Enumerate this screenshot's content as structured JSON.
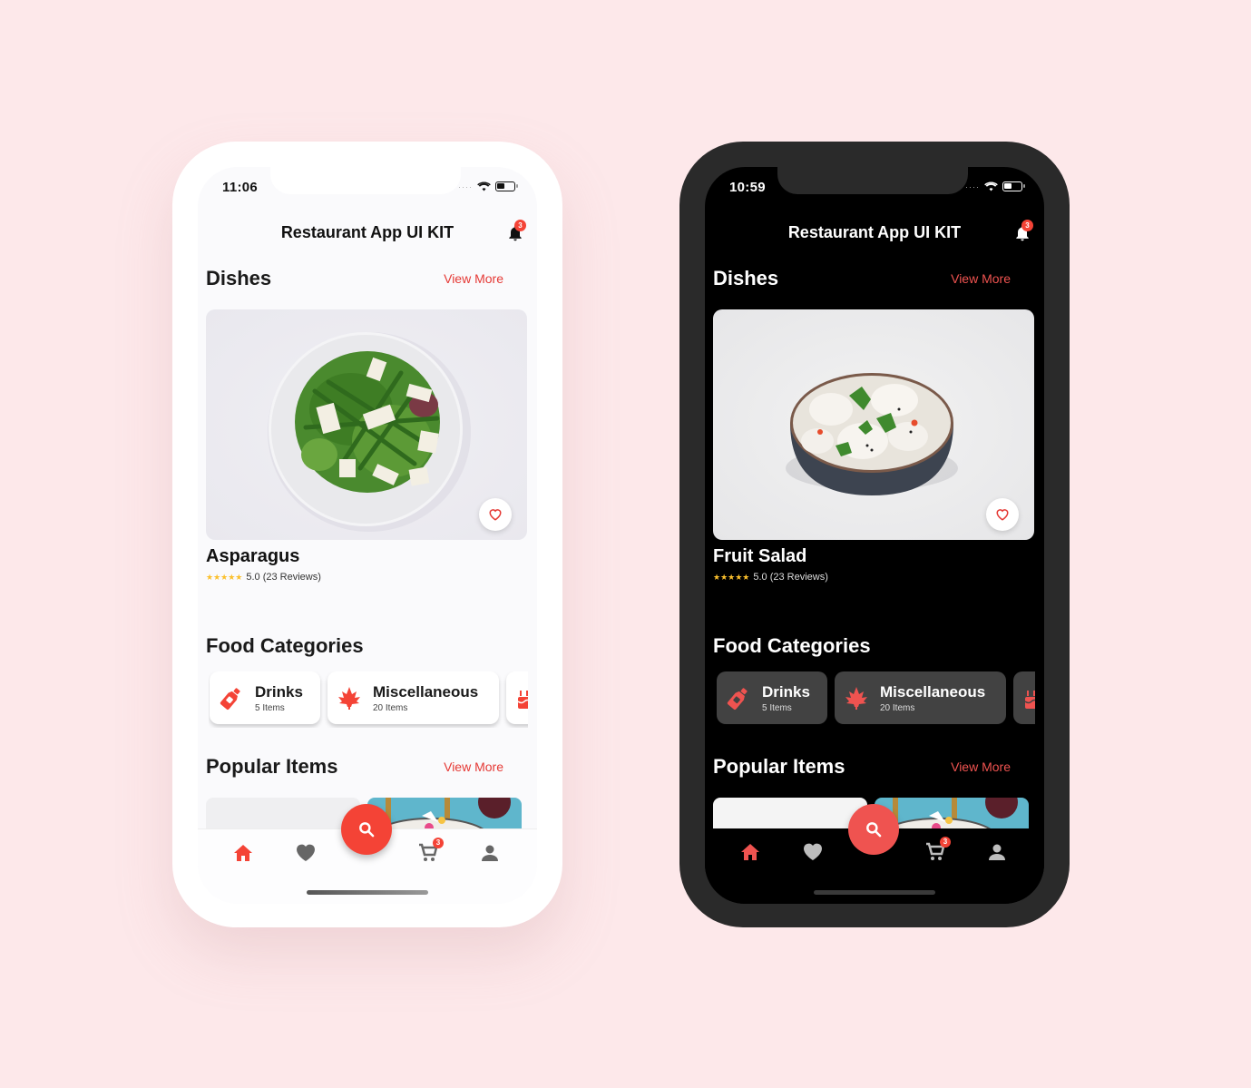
{
  "colors": {
    "background": "#fde8ea",
    "accent": "#f44336",
    "star": "#fbc02d"
  },
  "phones": [
    {
      "theme": "light",
      "status_time": "11:06",
      "app_title": "Restaurant App UI KIT",
      "notification_count": "3",
      "dishes": {
        "title": "Dishes",
        "view_more": "View More",
        "item": {
          "name": "Asparagus",
          "image": "asparagus-salad-plate",
          "stars": "★★★★★",
          "rating_text": "5.0 (23 Reviews)"
        }
      },
      "categories": {
        "title": "Food Categories",
        "items": [
          {
            "name": "Drinks",
            "count": "5 Items",
            "icon": "bottle-icon"
          },
          {
            "name": "Miscellaneous",
            "count": "20 Items",
            "icon": "leaf-icon"
          },
          {
            "name": "",
            "count": "",
            "icon": "cake-icon"
          }
        ]
      },
      "popular": {
        "title": "Popular Items",
        "view_more": "View More"
      },
      "bottom_nav": {
        "items": [
          "home",
          "favorites",
          "search",
          "cart",
          "profile"
        ],
        "active": "home",
        "cart_count": "3"
      }
    },
    {
      "theme": "dark",
      "status_time": "10:59",
      "app_title": "Restaurant App UI KIT",
      "notification_count": "3",
      "dishes": {
        "title": "Dishes",
        "view_more": "View More",
        "item": {
          "name": "Fruit Salad",
          "image": "dumplings-bowl",
          "stars": "★★★★★",
          "rating_text": "5.0 (23 Reviews)"
        }
      },
      "categories": {
        "title": "Food Categories",
        "items": [
          {
            "name": "Drinks",
            "count": "5 Items",
            "icon": "bottle-icon"
          },
          {
            "name": "Miscellaneous",
            "count": "20 Items",
            "icon": "leaf-icon"
          },
          {
            "name": "",
            "count": "",
            "icon": "cake-icon"
          }
        ]
      },
      "popular": {
        "title": "Popular Items",
        "view_more": "View More"
      },
      "bottom_nav": {
        "items": [
          "home",
          "favorites",
          "search",
          "cart",
          "profile"
        ],
        "active": "home",
        "cart_count": "3"
      }
    }
  ]
}
